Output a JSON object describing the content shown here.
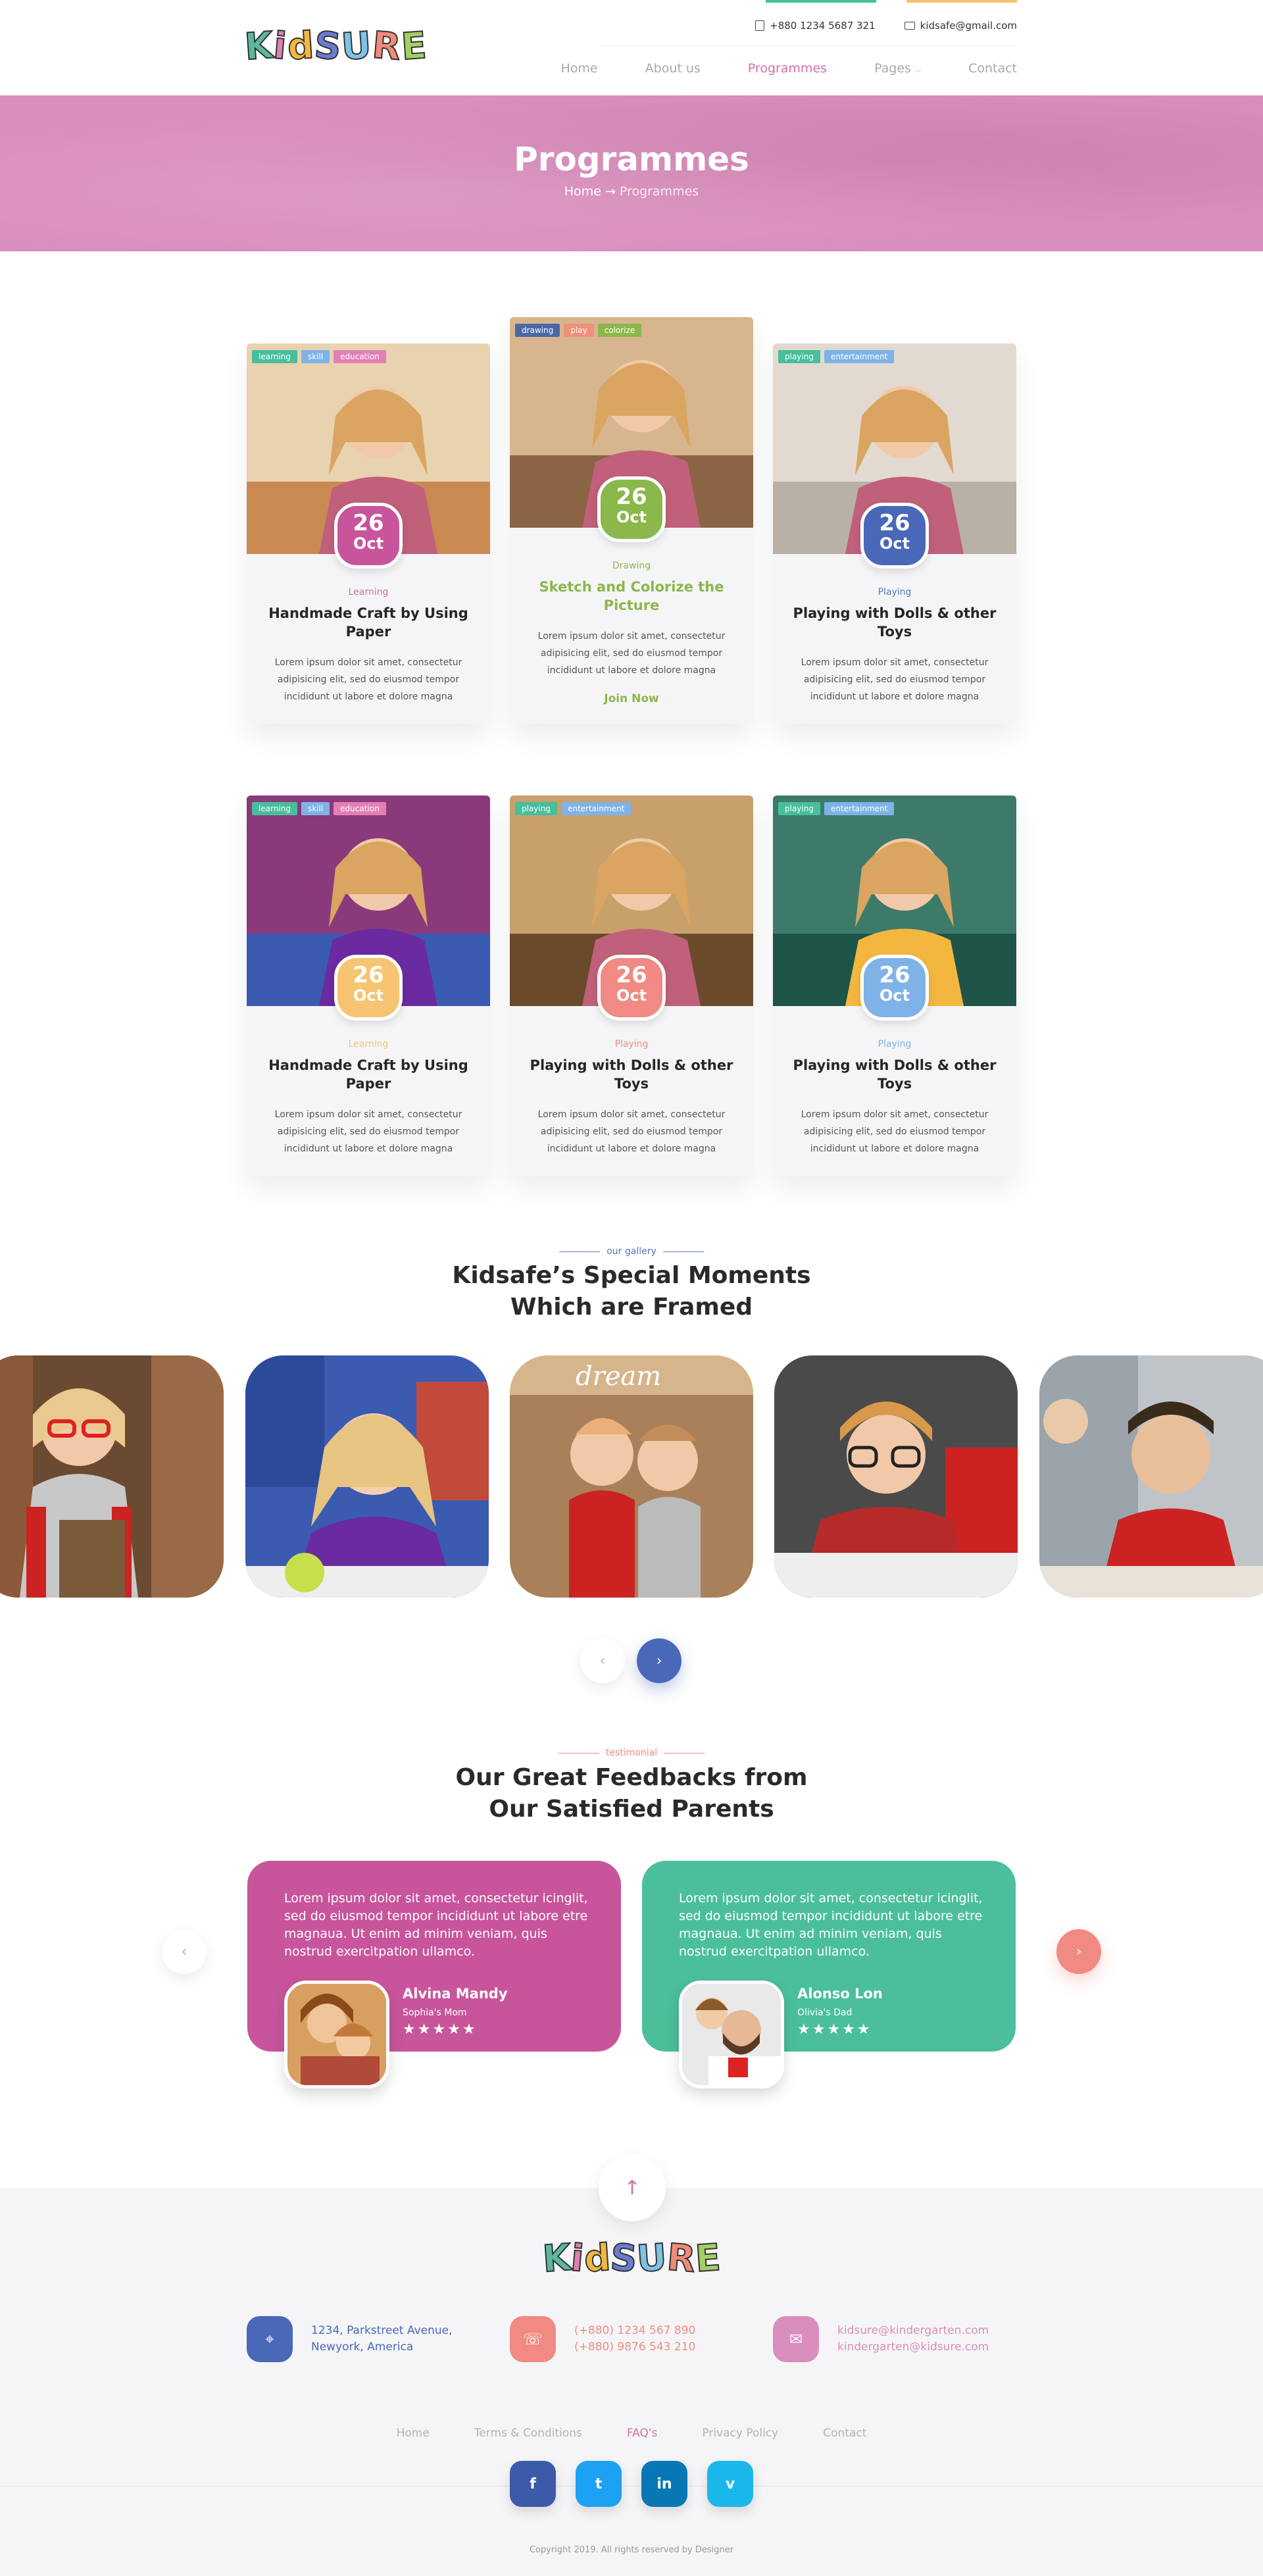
{
  "brand": {
    "name_letters": [
      "K",
      "i",
      "d",
      "S",
      "U",
      "R",
      "E"
    ],
    "letter_colors": [
      "#5ab8a0",
      "#e07fb1",
      "#f3b740",
      "#6a7bd0",
      "#7cc4e6",
      "#f08a7a",
      "#a3cf63"
    ]
  },
  "header": {
    "phone": "+880 1234 5687 321",
    "email": "kidsafe@gmail.com",
    "nav": [
      {
        "label": "Home"
      },
      {
        "label": "About us"
      },
      {
        "label": "Programmes",
        "active": true
      },
      {
        "label": "Pages"
      },
      {
        "label": "Contact"
      }
    ]
  },
  "banner": {
    "title": "Programmes",
    "crumb_home": "Home",
    "crumb_sep": "→",
    "crumb_current": "Programmes"
  },
  "programmes": [
    {
      "tags": [
        {
          "t": "learning",
          "c": "#47be9c"
        },
        {
          "t": "skill",
          "c": "#7fb3e8"
        },
        {
          "t": "education",
          "c": "#e47fb6"
        }
      ],
      "day": "26",
      "month": "Oct",
      "badge": "#c8559c",
      "category": "Learning",
      "cat_color": "#d36fa9",
      "title": "Handmade Craft by Using Paper",
      "desc": "Lorem ipsum dolor sit amet, consectetur adipisicing elit, sed do eiusmod tempor incididunt ut labore et dolore magna"
    },
    {
      "tags": [
        {
          "t": "drawing",
          "c": "#4a68a8"
        },
        {
          "t": "play",
          "c": "#f0907a"
        },
        {
          "t": "colorize",
          "c": "#8ab84a"
        }
      ],
      "day": "26",
      "month": "Oct",
      "badge": "#8ab84a",
      "category": "Drawing",
      "cat_color": "#8ab84a",
      "title": "Sketch and Colorize the Picture",
      "title_color": "#8ab84a",
      "desc": "Lorem ipsum dolor sit amet, consectetur adipisicing elit, sed do eiusmod tempor incididunt ut labore et dolore magna",
      "join": "Join Now"
    },
    {
      "tags": [
        {
          "t": "playing",
          "c": "#47be9c"
        },
        {
          "t": "entertainment",
          "c": "#7fb3e8"
        }
      ],
      "day": "26",
      "month": "Oct",
      "badge": "#4a68b8",
      "category": "Playing",
      "cat_color": "#5a77c0",
      "title": "Playing with Dolls & other Toys",
      "desc": "Lorem ipsum dolor sit amet, consectetur adipisicing elit, sed do eiusmod tempor incididunt ut labore et dolore magna"
    },
    {
      "tags": [
        {
          "t": "learning",
          "c": "#47be9c"
        },
        {
          "t": "skill",
          "c": "#7fb3e8"
        },
        {
          "t": "education",
          "c": "#e47fb6"
        }
      ],
      "day": "26",
      "month": "Oct",
      "badge": "#f6c472",
      "category": "Learning",
      "cat_color": "#f6c472",
      "title": "Handmade Craft by Using Paper",
      "desc": "Lorem ipsum dolor sit amet, consectetur adipisicing elit, sed do eiusmod tempor incididunt ut labore et dolore magna"
    },
    {
      "tags": [
        {
          "t": "playing",
          "c": "#47be9c"
        },
        {
          "t": "entertainment",
          "c": "#7fb3e8"
        }
      ],
      "day": "26",
      "month": "Oct",
      "badge": "#f08a82",
      "category": "Playing",
      "cat_color": "#f08a82",
      "title": "Playing with Dolls & other Toys",
      "desc": "Lorem ipsum dolor sit amet, consectetur adipisicing elit, sed do eiusmod tempor incididunt ut labore et dolore magna"
    },
    {
      "tags": [
        {
          "t": "playing",
          "c": "#47be9c"
        },
        {
          "t": "entertainment",
          "c": "#7fb3e8"
        }
      ],
      "day": "26",
      "month": "Oct",
      "badge": "#7fb3e8",
      "category": "Playing",
      "cat_color": "#7fb3e8",
      "title": "Playing with Dolls & other Toys",
      "desc": "Lorem ipsum dolor sit amet, consectetur adipisicing elit, sed do eiusmod tempor incididunt ut labore et dolore magna"
    }
  ],
  "gallery": {
    "label": "our gallery",
    "title_line1": "Kidsafe’s Special Moments",
    "title_line2": "Which are Framed"
  },
  "testimonial": {
    "label": "testimonial",
    "title_line1": "Our Great Feedbacks from",
    "title_line2": "Our Satisfied Parents",
    "items": [
      {
        "text": "Lorem ipsum dolor sit amet, consectetur icinglit, sed do eiusmod tempor incididunt ut labore etre magnaua. Ut enim ad minim veniam, quis nostrud exercitpation ullamco.",
        "name": "Alvina Mandy",
        "role": "Sophia's Mom",
        "stars": "★★★★★",
        "color": "#c8559c"
      },
      {
        "text": "Lorem ipsum dolor sit amet, consectetur icinglit, sed do eiusmod tempor incididunt ut labore etre magnaua. Ut enim ad minim veniam, quis nostrud exercitpation ullamco.",
        "name": "Alonso Lon",
        "role": "Olivia's Dad",
        "stars": "★★★★★",
        "color": "#4bbf9b"
      }
    ]
  },
  "footer": {
    "address_l1": "1234, Parkstreet Avenue,",
    "address_l2": "Newyork, America",
    "phone_l1": "(+880) 1234 567 890",
    "phone_l2": "(+880) 9876 543 210",
    "email_l1": "kidsure@kindergarten.com",
    "email_l2": "kindergarten@kidsure.com",
    "links": [
      {
        "label": "Home"
      },
      {
        "label": "Terms & Conditions"
      },
      {
        "label": "FAQ's",
        "active": true
      },
      {
        "label": "Privacy Policy"
      },
      {
        "label": "Contact"
      }
    ],
    "socials": [
      {
        "glyph": "f",
        "color": "#3b5ba8"
      },
      {
        "glyph": "t",
        "color": "#1da1f2"
      },
      {
        "glyph": "in",
        "color": "#0a77b5"
      },
      {
        "glyph": "v",
        "color": "#1ab7ea"
      }
    ],
    "copyright": "Copyright 2019. All rights reserved by Designer"
  }
}
